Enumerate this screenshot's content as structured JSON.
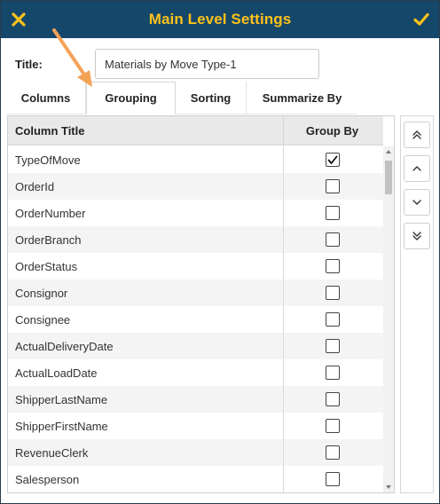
{
  "dialog": {
    "title": "Main Level Settings",
    "close_icon": "close-icon",
    "confirm_icon": "checkmark-icon",
    "accent_color": "#ffc21a",
    "titlebar_color": "#15476a",
    "callout_color": "#f4a258"
  },
  "title_field": {
    "label": "Title:",
    "value": "Materials by Move Type-1"
  },
  "tabs": [
    {
      "label": "Columns",
      "active": false
    },
    {
      "label": "Grouping",
      "active": true
    },
    {
      "label": "Sorting",
      "active": false
    },
    {
      "label": "Summarize By",
      "active": false
    }
  ],
  "grid": {
    "headers": [
      "Column Title",
      "Group By"
    ],
    "rows": [
      {
        "name": "TypeOfMove",
        "checked": true
      },
      {
        "name": "OrderId",
        "checked": false
      },
      {
        "name": "OrderNumber",
        "checked": false
      },
      {
        "name": "OrderBranch",
        "checked": false
      },
      {
        "name": "OrderStatus",
        "checked": false
      },
      {
        "name": "Consignor",
        "checked": false
      },
      {
        "name": "Consignee",
        "checked": false
      },
      {
        "name": "ActualDeliveryDate",
        "checked": false
      },
      {
        "name": "ActualLoadDate",
        "checked": false
      },
      {
        "name": "ShipperLastName",
        "checked": false
      },
      {
        "name": "ShipperFirstName",
        "checked": false
      },
      {
        "name": "RevenueClerk",
        "checked": false
      },
      {
        "name": "Salesperson",
        "checked": false
      }
    ]
  },
  "move_buttons": [
    {
      "icon": "double-chevron-up-icon"
    },
    {
      "icon": "chevron-up-icon"
    },
    {
      "icon": "chevron-down-icon"
    },
    {
      "icon": "double-chevron-down-icon"
    }
  ]
}
